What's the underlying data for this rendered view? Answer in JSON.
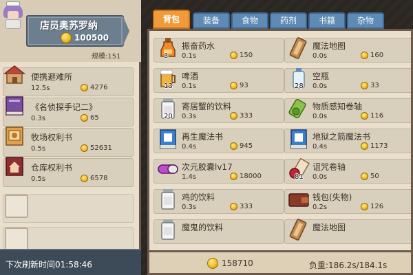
{
  "shop": {
    "name": "店员奥苏罗纳",
    "gold": "100500",
    "scale": "规模:151"
  },
  "left_items": [
    {
      "title": "便携避难所",
      "time": "12.5s",
      "price": "4276",
      "icon": "house-icon"
    },
    {
      "title": "《名侦探手记二》",
      "time": "0.3s",
      "price": "65",
      "icon": "book-icon"
    },
    {
      "title": "牧场权利书",
      "time": "0.5s",
      "price": "52631",
      "icon": "scroll-deed-icon"
    },
    {
      "title": "仓库权利书",
      "time": "0.5s",
      "price": "6578",
      "icon": "warehouse-deed-icon"
    }
  ],
  "refresh": "下次刷新时间01:58:46",
  "tabs": [
    "背包",
    "装备",
    "食物",
    "药剂",
    "书籍",
    "杂物"
  ],
  "active_tab": "背包",
  "inventory": [
    {
      "title": "振奋药水",
      "time": "0.1s",
      "price": "150",
      "count": "3",
      "icon": "potion-icon"
    },
    {
      "title": "魔法地图",
      "time": "0.0s",
      "price": "160",
      "count": "",
      "icon": "map-icon"
    },
    {
      "title": "啤酒",
      "time": "0.1s",
      "price": "93",
      "count": "13",
      "icon": "beer-icon"
    },
    {
      "title": "空瓶",
      "time": "0.0s",
      "price": "33",
      "count": "28",
      "icon": "empty-bottle-icon"
    },
    {
      "title": "寄居蟹的饮料",
      "time": "0.3s",
      "price": "333",
      "count": "20",
      "icon": "jar-drink-icon"
    },
    {
      "title": "物质感知卷轴",
      "time": "0.0s",
      "price": "116",
      "count": "",
      "icon": "green-scroll-icon"
    },
    {
      "title": "再生魔法书",
      "time": "0.4s",
      "price": "945",
      "count": "",
      "icon": "magic-book-icon"
    },
    {
      "title": "地狱之箭魔法书",
      "time": "0.4s",
      "price": "1173",
      "count": "",
      "icon": "magic-book-icon"
    },
    {
      "title": "次元胶囊lv17",
      "time": "1.4s",
      "price": "18000",
      "count": "",
      "icon": "capsule-icon"
    },
    {
      "title": "诅咒卷轴",
      "time": "0.0s",
      "price": "50",
      "count": "81",
      "icon": "curse-scroll-icon"
    },
    {
      "title": "鸡的饮料",
      "time": "0.3s",
      "price": "333",
      "count": "",
      "icon": "jar-drink-icon"
    },
    {
      "title": "钱包(失物)",
      "time": "0.2s",
      "price": "126",
      "count": "",
      "icon": "wallet-icon"
    },
    {
      "title": "魔鬼的饮料",
      "time": "",
      "price": "",
      "count": "",
      "icon": "jar-drink-icon"
    },
    {
      "title": "魔法地图",
      "time": "",
      "price": "",
      "count": "",
      "icon": "map-icon"
    }
  ],
  "footer": {
    "gold": "158710",
    "load": "负重:186.2s/184.1s"
  },
  "colors": {
    "tab_active": "#f09b3a",
    "tab_inactive": "#5d8bb5",
    "panel": "#e9dfcc",
    "item": "#d9cfbd",
    "refresh_bar": "#3d4a57"
  }
}
